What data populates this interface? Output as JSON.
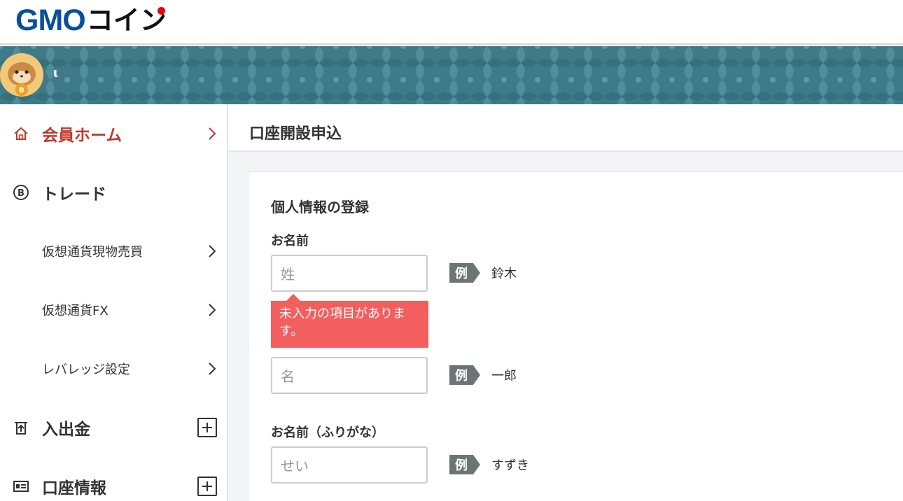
{
  "header": {
    "logo_gmo": "GMO",
    "logo_coin": "コイン"
  },
  "user": {
    "name": "ι"
  },
  "sidebar": {
    "items": [
      {
        "label": "会員ホーム",
        "icon": "home-icon",
        "control": "chevron",
        "active": true
      },
      {
        "label": "トレード",
        "icon": "bitcoin-icon",
        "control": "none",
        "active": false
      },
      {
        "label": "仮想通貨現物売買",
        "icon": "",
        "control": "chevron",
        "active": false
      },
      {
        "label": "仮想通貨FX",
        "icon": "",
        "control": "chevron",
        "active": false
      },
      {
        "label": "レバレッジ設定",
        "icon": "",
        "control": "chevron",
        "active": false
      },
      {
        "label": "入出金",
        "icon": "deposit-withdraw-icon",
        "control": "plus",
        "active": false
      },
      {
        "label": "口座情報",
        "icon": "id-card-icon",
        "control": "plus",
        "active": false
      }
    ]
  },
  "page": {
    "title": "口座開設申込"
  },
  "form": {
    "section_title": "個人情報の登録",
    "name_label": "お名前",
    "last_name_placeholder": "姓",
    "last_name_example_badge": "例",
    "last_name_example": "鈴木",
    "error_message": "未入力の項目があります。",
    "first_name_placeholder": "名",
    "first_name_example_badge": "例",
    "first_name_example": "一郎",
    "kana_label": "お名前（ふりがな）",
    "last_kana_placeholder": "せい",
    "last_kana_example_badge": "例",
    "last_kana_example": "すずき"
  },
  "colors": {
    "brand_blue": "#0a4f9c",
    "banner": "#3f7a88",
    "active_red": "#c0392b",
    "error_bg": "#f35e5e",
    "example_badge": "#6c7478"
  }
}
